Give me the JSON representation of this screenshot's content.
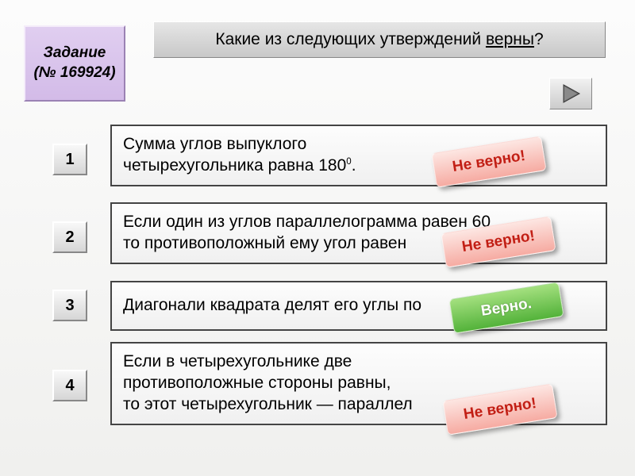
{
  "task": {
    "label": "Задание",
    "num_prefix": "(№ ",
    "num": "169924",
    "num_suffix": ")"
  },
  "question": {
    "text_before": "Какие из следующих утверждений ",
    "underlined": "верны",
    "after": "?"
  },
  "nav": {
    "icon": "play-right"
  },
  "options": [
    {
      "num": "1",
      "text_a": "Сумма углов выпуклого",
      "text_b": "четырехугольника равна 180",
      "sup": "0",
      "text_c": ".",
      "verdict": "wrong",
      "verdict_label": "Не верно!"
    },
    {
      "num": "2",
      "text_a": "Если один из углов параллелограмма равен 60",
      "sup1": "",
      "text_b": "то противоположный ему угол равен",
      "verdict": "wrong",
      "verdict_label": "Не верно!"
    },
    {
      "num": "3",
      "text_a": "Диагонали квадрата делят его углы по",
      "verdict": "right",
      "verdict_label": "Верно."
    },
    {
      "num": "4",
      "text_a": "Если в четырехугольнике две",
      "text_b": "противоположные стороны равны,",
      "text_c": "то этот четырехугольник — параллел",
      "verdict": "wrong",
      "verdict_label": "Не верно!"
    }
  ]
}
